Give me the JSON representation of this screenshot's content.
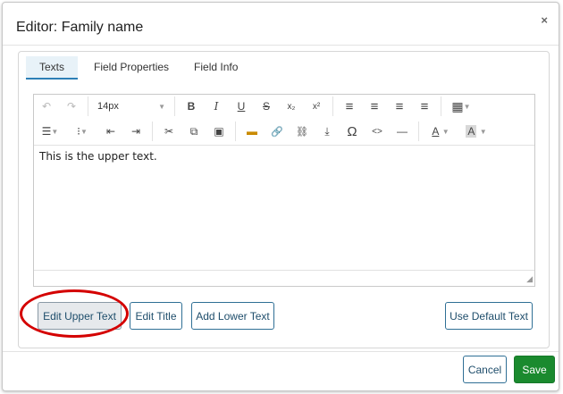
{
  "dialog": {
    "title": "Editor: Family name",
    "close_icon": "×"
  },
  "tabs": [
    {
      "label": "Texts",
      "active": true
    },
    {
      "label": "Field Properties",
      "active": false
    },
    {
      "label": "Field Info",
      "active": false
    }
  ],
  "toolbar": {
    "font_size": "14px",
    "icons": {
      "undo": "↶",
      "redo": "↷",
      "bold": "B",
      "italic": "I",
      "underline": "U",
      "strike": "S",
      "subscript": "x₂",
      "superscript": "x²",
      "align_left": "≡",
      "align_center": "≡",
      "align_right": "≡",
      "justify": "≡",
      "table": "▦",
      "bullet_list": "☰",
      "numbered_list": "⁝",
      "outdent": "⇤",
      "indent": "⇥",
      "cut": "✂",
      "copy": "⧉",
      "paste": "▣",
      "image": "▬",
      "link": "🔗",
      "unlink": "⛓",
      "insert": "⤓",
      "omega": "Ω",
      "code": "<>",
      "hr": "—",
      "font_color": "A",
      "bg_color": "A"
    }
  },
  "editor": {
    "content": "This is the upper text."
  },
  "buttons": {
    "edit_upper": "Edit Upper Text",
    "edit_title": "Edit Title",
    "add_lower": "Add Lower Text",
    "use_default": "Use Default Text"
  },
  "footer": {
    "cancel": "Cancel",
    "save": "Save"
  },
  "colors": {
    "accent": "#2d7fb6",
    "save_bg": "#1a8a2e",
    "highlight_circle": "#d40000"
  }
}
